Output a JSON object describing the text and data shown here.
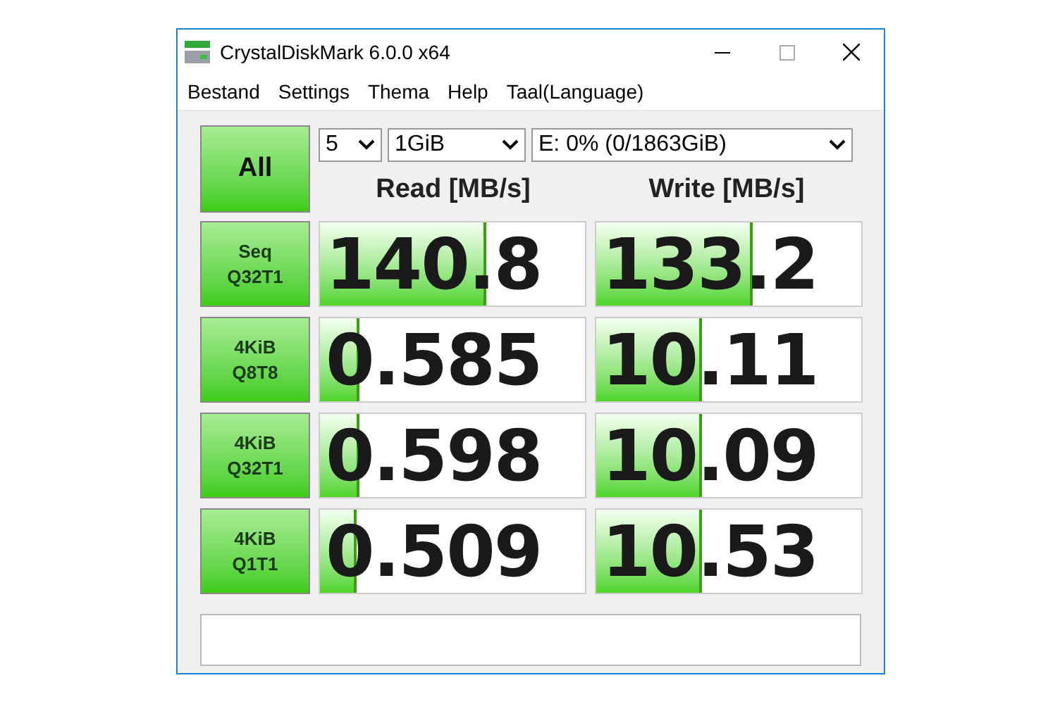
{
  "window": {
    "title": "CrystalDiskMark 6.0.0 x64"
  },
  "menu": [
    "Bestand",
    "Settings",
    "Thema",
    "Help",
    "Taal(Language)"
  ],
  "all_button": "All",
  "selectors": [
    {
      "value": "5"
    },
    {
      "value": "1GiB"
    },
    {
      "value": "E: 0% (0/1863GiB)"
    }
  ],
  "headers": [
    "Read [MB/s]",
    "Write [MB/s]"
  ],
  "rows": [
    {
      "label": [
        "Seq",
        "Q32T1"
      ],
      "read": {
        "value": "140.8",
        "level": 0.63
      },
      "write": {
        "value": "133.2",
        "level": 0.59
      }
    },
    {
      "label": [
        "4KiB",
        "Q8T8"
      ],
      "read": {
        "value": "0.585",
        "level": 0.15
      },
      "write": {
        "value": "10.11",
        "level": 0.4
      }
    },
    {
      "label": [
        "4KiB",
        "Q32T1"
      ],
      "read": {
        "value": "0.598",
        "level": 0.15
      },
      "write": {
        "value": "10.09",
        "level": 0.4
      }
    },
    {
      "label": [
        "4KiB",
        "Q1T1"
      ],
      "read": {
        "value": "0.509",
        "level": 0.14
      },
      "write": {
        "value": "10.53",
        "level": 0.4
      }
    }
  ]
}
